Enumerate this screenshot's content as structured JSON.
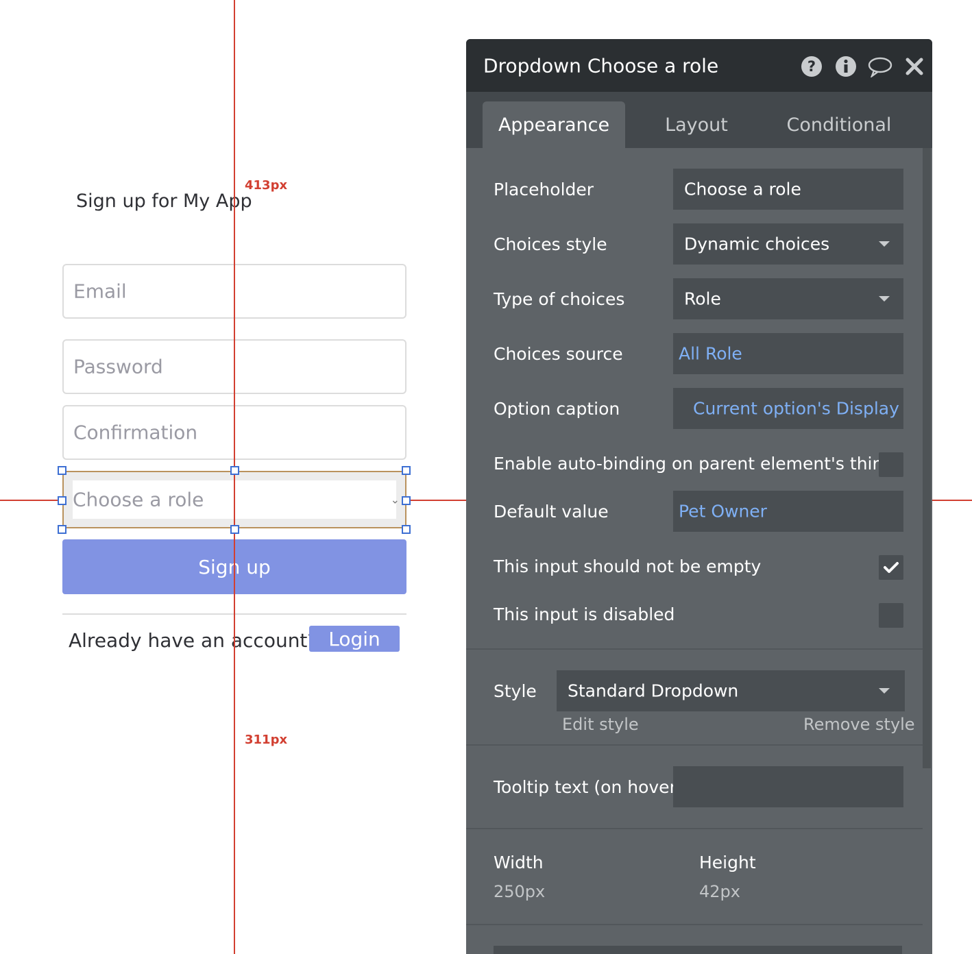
{
  "app": {
    "title": "Sign up for My App",
    "email_placeholder": "Email",
    "password_placeholder": "Password",
    "confirmation_placeholder": "Confirmation",
    "dropdown_placeholder": "Choose a role",
    "signup_label": "Sign up",
    "already_text": "Already have an account?",
    "login_label": "Login"
  },
  "guides": {
    "top_distance": "413px",
    "bottom_distance": "311px"
  },
  "panel": {
    "title": "Dropdown Choose a role",
    "tabs": [
      "Appearance",
      "Layout",
      "Conditional"
    ],
    "active_tab": "Appearance",
    "header_icons": [
      "help-icon",
      "info-icon",
      "comment-icon",
      "close-icon"
    ],
    "props": {
      "placeholder_label": "Placeholder",
      "placeholder_value": "Choose a role",
      "choices_style_label": "Choices style",
      "choices_style_value": "Dynamic choices",
      "type_label": "Type of choices",
      "type_value": "Role",
      "source_label": "Choices source",
      "source_value": "All Role",
      "caption_label": "Option caption",
      "caption_value": "Current option's Display",
      "autobind_label": "Enable auto-binding on parent element's thing",
      "autobind_checked": false,
      "default_label": "Default value",
      "default_value": "Pet Owner",
      "not_empty_label": "This input should not be empty",
      "not_empty_checked": true,
      "disabled_label": "This input is disabled",
      "disabled_checked": false
    },
    "style": {
      "label": "Style",
      "value": "Standard Dropdown",
      "edit_label": "Edit style",
      "remove_label": "Remove style"
    },
    "tooltip": {
      "label": "Tooltip text (on hover)",
      "value": ""
    },
    "size": {
      "width_label": "Width",
      "width_value": "250px",
      "height_label": "Height",
      "height_value": "42px"
    },
    "colors": {
      "header_bg": "#2b2f32",
      "panel_bg": "#5e6367",
      "field_bg": "#494e52",
      "link_blue": "#7fb0f5",
      "button_purple": "#8193e3",
      "guide_red": "#d23f31"
    }
  }
}
